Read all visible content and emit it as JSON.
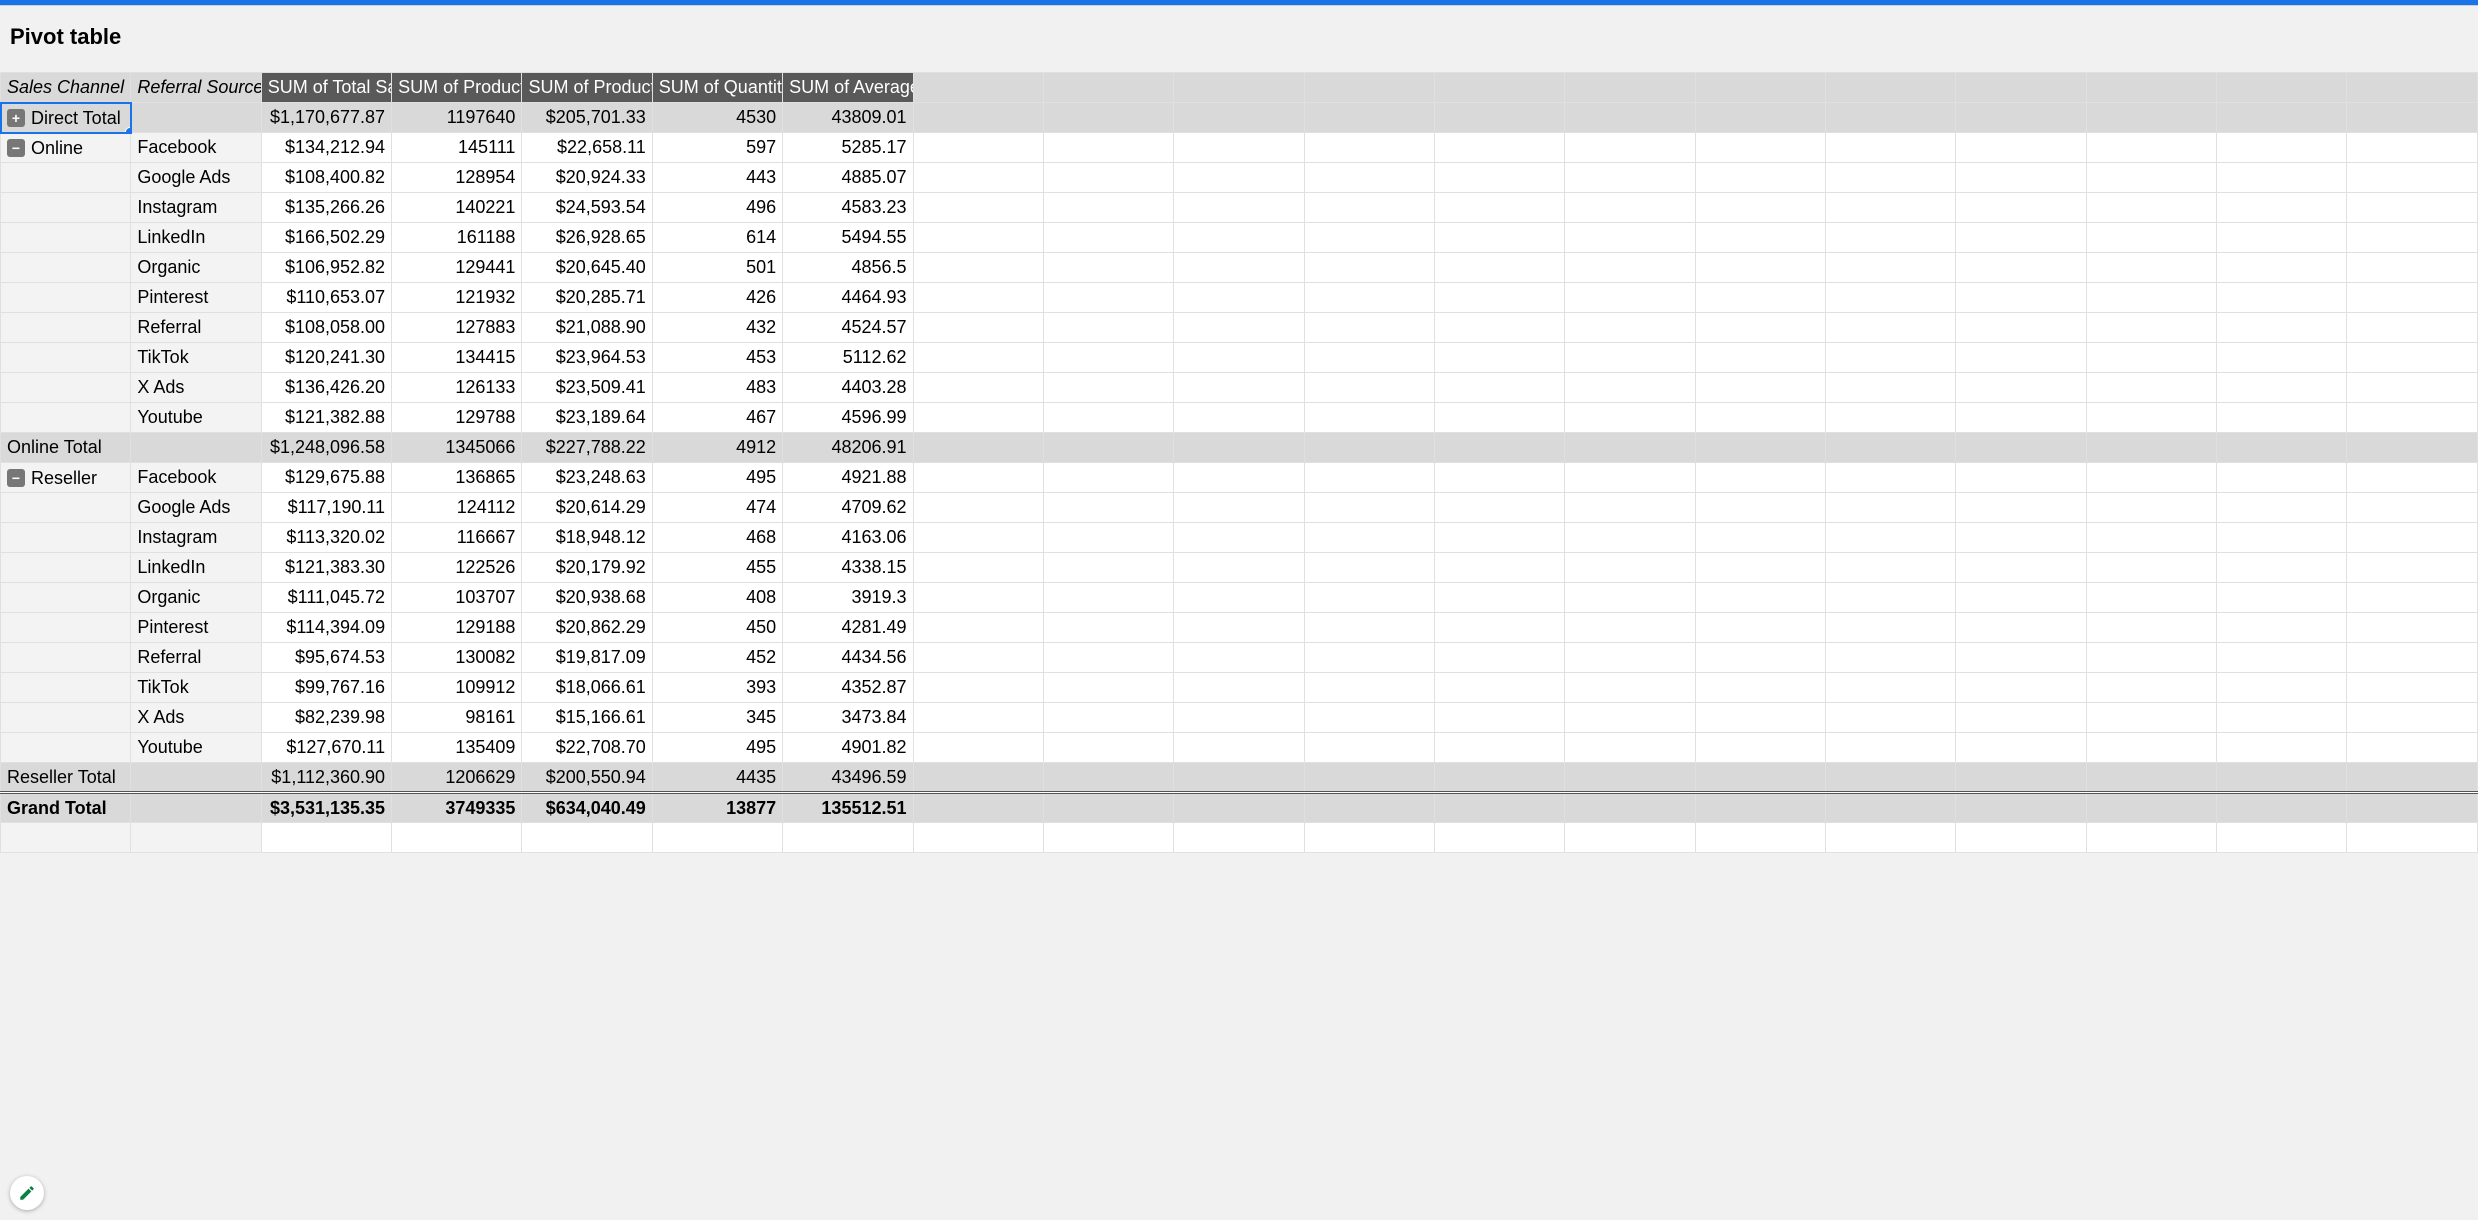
{
  "title": "Pivot table",
  "headers": {
    "sales_channel": "Sales Channel",
    "referral_source": "Referral Source",
    "v1": "SUM of Total Sa",
    "v2": "SUM of Product",
    "v3": "SUM of Product",
    "v4": "SUM of Quantity",
    "v5": "SUM of Average"
  },
  "groups": [
    {
      "channel": "Direct",
      "collapsed": true,
      "toggle_sym": "+",
      "header_label": "Direct Total",
      "details": [],
      "subtotal": {
        "label": "Direct Total",
        "v1": "$1,170,677.87",
        "v2": "1197640",
        "v3": "$205,701.33",
        "v4": "4530",
        "v5": "43809.01"
      }
    },
    {
      "channel": "Online",
      "collapsed": false,
      "toggle_sym": "−",
      "header_label": "Online",
      "details": [
        {
          "ref": "Facebook",
          "v1": "$134,212.94",
          "v2": "145111",
          "v3": "$22,658.11",
          "v4": "597",
          "v5": "5285.17"
        },
        {
          "ref": "Google Ads",
          "v1": "$108,400.82",
          "v2": "128954",
          "v3": "$20,924.33",
          "v4": "443",
          "v5": "4885.07"
        },
        {
          "ref": "Instagram",
          "v1": "$135,266.26",
          "v2": "140221",
          "v3": "$24,593.54",
          "v4": "496",
          "v5": "4583.23"
        },
        {
          "ref": "LinkedIn",
          "v1": "$166,502.29",
          "v2": "161188",
          "v3": "$26,928.65",
          "v4": "614",
          "v5": "5494.55"
        },
        {
          "ref": "Organic",
          "v1": "$106,952.82",
          "v2": "129441",
          "v3": "$20,645.40",
          "v4": "501",
          "v5": "4856.5"
        },
        {
          "ref": "Pinterest",
          "v1": "$110,653.07",
          "v2": "121932",
          "v3": "$20,285.71",
          "v4": "426",
          "v5": "4464.93"
        },
        {
          "ref": "Referral",
          "v1": "$108,058.00",
          "v2": "127883",
          "v3": "$21,088.90",
          "v4": "432",
          "v5": "4524.57"
        },
        {
          "ref": "TikTok",
          "v1": "$120,241.30",
          "v2": "134415",
          "v3": "$23,964.53",
          "v4": "453",
          "v5": "5112.62"
        },
        {
          "ref": "X Ads",
          "v1": "$136,426.20",
          "v2": "126133",
          "v3": "$23,509.41",
          "v4": "483",
          "v5": "4403.28"
        },
        {
          "ref": "Youtube",
          "v1": "$121,382.88",
          "v2": "129788",
          "v3": "$23,189.64",
          "v4": "467",
          "v5": "4596.99"
        }
      ],
      "subtotal": {
        "label": "Online Total",
        "v1": "$1,248,096.58",
        "v2": "1345066",
        "v3": "$227,788.22",
        "v4": "4912",
        "v5": "48206.91"
      }
    },
    {
      "channel": "Reseller",
      "collapsed": false,
      "toggle_sym": "−",
      "header_label": "Reseller",
      "details": [
        {
          "ref": "Facebook",
          "v1": "$129,675.88",
          "v2": "136865",
          "v3": "$23,248.63",
          "v4": "495",
          "v5": "4921.88"
        },
        {
          "ref": "Google Ads",
          "v1": "$117,190.11",
          "v2": "124112",
          "v3": "$20,614.29",
          "v4": "474",
          "v5": "4709.62"
        },
        {
          "ref": "Instagram",
          "v1": "$113,320.02",
          "v2": "116667",
          "v3": "$18,948.12",
          "v4": "468",
          "v5": "4163.06"
        },
        {
          "ref": "LinkedIn",
          "v1": "$121,383.30",
          "v2": "122526",
          "v3": "$20,179.92",
          "v4": "455",
          "v5": "4338.15"
        },
        {
          "ref": "Organic",
          "v1": "$111,045.72",
          "v2": "103707",
          "v3": "$20,938.68",
          "v4": "408",
          "v5": "3919.3"
        },
        {
          "ref": "Pinterest",
          "v1": "$114,394.09",
          "v2": "129188",
          "v3": "$20,862.29",
          "v4": "450",
          "v5": "4281.49"
        },
        {
          "ref": "Referral",
          "v1": "$95,674.53",
          "v2": "130082",
          "v3": "$19,817.09",
          "v4": "452",
          "v5": "4434.56"
        },
        {
          "ref": "TikTok",
          "v1": "$99,767.16",
          "v2": "109912",
          "v3": "$18,066.61",
          "v4": "393",
          "v5": "4352.87"
        },
        {
          "ref": "X Ads",
          "v1": "$82,239.98",
          "v2": "98161",
          "v3": "$15,166.61",
          "v4": "345",
          "v5": "3473.84"
        },
        {
          "ref": "Youtube",
          "v1": "$127,670.11",
          "v2": "135409",
          "v3": "$22,708.70",
          "v4": "495",
          "v5": "4901.82"
        }
      ],
      "subtotal": {
        "label": "Reseller Total",
        "v1": "$1,112,360.90",
        "v2": "1206629",
        "v3": "$200,550.94",
        "v4": "4435",
        "v5": "43496.59"
      }
    }
  ],
  "grand_total": {
    "label": "Grand Total",
    "v1": "$3,531,135.35",
    "v2": "3749335",
    "v3": "$634,040.49",
    "v4": "13877",
    "v5": "135512.51"
  },
  "blank_cols": 12,
  "trailing_blank_rows": 1
}
